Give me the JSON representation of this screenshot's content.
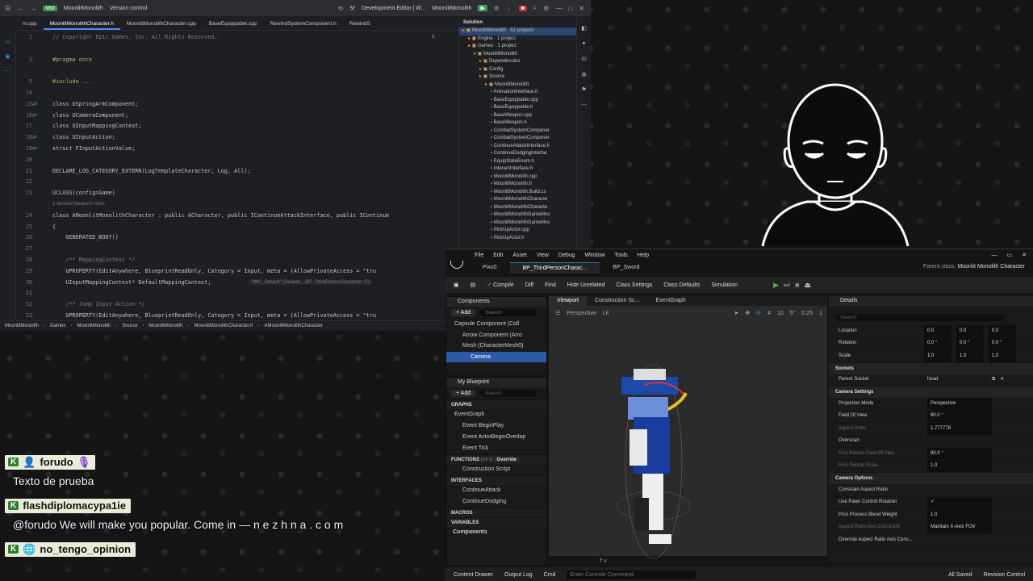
{
  "ide": {
    "title_bar": {
      "project": "MoonlitMonolith",
      "vcs": "Version control",
      "config": "Development Editor | W...",
      "run_target": "MoonlitMonolith"
    },
    "tabs": [
      "nt.cpp",
      "MoonlitMonolithCharacter.h",
      "MoonlitMonolithCharacter.cpp",
      "BaseEquippable.cpp",
      "RewindSystemComponent.h",
      "RewindS"
    ],
    "warnings": "1",
    "gutter": [
      "1",
      "",
      "3",
      "",
      "5",
      "14",
      "15",
      "16",
      "17",
      "18",
      "19",
      "20",
      "21",
      "22",
      "23",
      "",
      "24",
      "25",
      "26",
      "27",
      "28",
      "29",
      "30",
      "31",
      "32",
      "33"
    ],
    "code": [
      {
        "t": "// Copyright Epic Games, Inc. All Rights Reserved.",
        "c": "cm"
      },
      {
        "t": "",
        "c": ""
      },
      {
        "t": "#pragma once",
        "c": "pp"
      },
      {
        "t": "",
        "c": ""
      },
      {
        "t": "#include ...",
        "c": "pp"
      },
      {
        "t": "",
        "c": ""
      },
      {
        "t": "class USpringArmComponent;",
        "c": "ty"
      },
      {
        "t": "class UCameraComponent;",
        "c": "ty"
      },
      {
        "t": "class UInputMappingContext;",
        "c": "ty"
      },
      {
        "t": "class UInputAction;",
        "c": "ty"
      },
      {
        "t": "struct FInputActionValue;",
        "c": "ty"
      },
      {
        "t": "",
        "c": ""
      },
      {
        "t": "DECLARE_LOG_CATEGORY_EXTERN(LogTemplateCharacter, Log, All);",
        "c": "ty"
      },
      {
        "t": "",
        "c": ""
      },
      {
        "t": "UCLASS(config=Game)",
        "c": "ty"
      },
      {
        "t": "1 derived blueprint class",
        "c": "hint"
      },
      {
        "t": "class AMoonlitMonolithCharacter : public ACharacter, public IContinueAttackInterface, public IContinue",
        "c": "ty"
      },
      {
        "t": "{",
        "c": "ty"
      },
      {
        "t": "    GENERATED_BODY()",
        "c": "ty"
      },
      {
        "t": "",
        "c": ""
      },
      {
        "t": "    /** MappingContext */",
        "c": "cm"
      },
      {
        "t": "    UPROPERTY(EditAnywhere, BlueprintReadOnly, Category = Input, meta = (AllowPrivateAccess = \"tru",
        "c": "ty"
      },
      {
        "t": "    UInputMappingContext* DefaultMappingContext;",
        "c": "ty"
      },
      {
        "t": "",
        "c": ""
      },
      {
        "t": "    /** Jump Input Action */",
        "c": "cm"
      },
      {
        "t": "    UPROPERTY(EditAnywhere, BlueprintReadOnly, Category = Input, meta = (AllowPrivateAccess = \"tru",
        "c": "ty"
      }
    ],
    "inline_hint": "\"IMC_Default\" (Default__BP_ThirdPersonCharacter_C)",
    "solution": {
      "header": "Solution",
      "items": [
        {
          "label": "MoonlitMonolith · 52 projects",
          "indent": 0,
          "sel": true
        },
        {
          "label": "Engine · 1 project",
          "indent": 1
        },
        {
          "label": "Games · 1 project",
          "indent": 1
        },
        {
          "label": "MoonlitMonolith",
          "indent": 2
        },
        {
          "label": "Dependencies",
          "indent": 3
        },
        {
          "label": "Config",
          "indent": 3
        },
        {
          "label": "Source",
          "indent": 3
        },
        {
          "label": "MoonlitMonolith",
          "indent": 4
        },
        {
          "label": "AnimationInterface.h",
          "indent": 5
        },
        {
          "label": "BaseEquippable.cpp",
          "indent": 5
        },
        {
          "label": "BaseEquippable.h",
          "indent": 5
        },
        {
          "label": "BaseWeapon.cpp",
          "indent": 5
        },
        {
          "label": "BaseWeapon.h",
          "indent": 5
        },
        {
          "label": "CombatSystemComponer",
          "indent": 5
        },
        {
          "label": "CombatSystemComponer",
          "indent": 5
        },
        {
          "label": "ContinueAttackInterface.h",
          "indent": 5
        },
        {
          "label": "ContinueDodgingInterfac",
          "indent": 5
        },
        {
          "label": "EquipStateEnum.h",
          "indent": 5
        },
        {
          "label": "InteractInterface.h",
          "indent": 5
        },
        {
          "label": "MoonlitMonolith.cpp",
          "indent": 5
        },
        {
          "label": "MoonlitMonolith.h",
          "indent": 5
        },
        {
          "label": "MoonlitMonolith.Build.cs",
          "indent": 5
        },
        {
          "label": "MoonlitMonolithCharacte",
          "indent": 5
        },
        {
          "label": "MoonlitMonolithCharacte",
          "indent": 5
        },
        {
          "label": "MoonlitMonolithGameMoc",
          "indent": 5
        },
        {
          "label": "MoonlitMonolithGameMoc",
          "indent": 5
        },
        {
          "label": "PickUpActor.cpp",
          "indent": 5
        },
        {
          "label": "PickUpActor.h",
          "indent": 5
        }
      ]
    },
    "breadcrumb": [
      "MoonlitMonolith",
      "Games",
      "MoonlitMonolith",
      "Source",
      "MoonlitMonolith",
      "MoonlitMonolithCharacter.h",
      "AMoonlitMonolithCharacter"
    ]
  },
  "ue": {
    "menu": [
      "File",
      "Edit",
      "Asset",
      "View",
      "Debug",
      "Window",
      "Tools",
      "Help"
    ],
    "tabs": [
      "Pixo0",
      "BP_ThirdPersonCharac...",
      "BP_Sword"
    ],
    "parent_class_label": "Parent class:",
    "parent_class": "Moonlit Monolith Character",
    "toolbar": [
      "Compile",
      "Diff",
      "Find",
      "Hide Unrelated",
      "Class Settings",
      "Class Defaults",
      "Simulation"
    ],
    "components": {
      "title": "Components",
      "add": "+ Add",
      "search": "Search",
      "items": [
        {
          "label": "Capsule Component (Coll",
          "indent": 1
        },
        {
          "label": "Arrow Component (Arro",
          "indent": 2
        },
        {
          "label": "Mesh (CharacterMesh0)",
          "indent": 2
        },
        {
          "label": "Camera",
          "indent": 3,
          "sel": true
        }
      ]
    },
    "blueprint": {
      "title": "My Blueprint",
      "add": "+ Add",
      "search": "Search",
      "graphs": "GRAPHS",
      "graph_items": [
        "EventGraph",
        "Event BeginPlay",
        "Event ActorBeginOverlap",
        "Event Tick"
      ],
      "functions": "FUNCTIONS",
      "functions_count": "(34 O",
      "override": "Override",
      "function_items": [
        "Construction Script"
      ],
      "interfaces": "INTERFACES",
      "interface_items": [
        "ContinueAttack",
        "ContinueDodging"
      ],
      "macros": "MACROS",
      "variables": "VARIABLES",
      "components_var": "Components"
    },
    "viewport": {
      "tabs": [
        "Viewport",
        "Construction Sc...",
        "EventGraph"
      ],
      "perspective": "Perspective",
      "lit": "Lit",
      "grid": "10",
      "angle": "5°",
      "scale": "0.25",
      "cam": "1"
    },
    "details": {
      "title": "Details",
      "search": "Search",
      "transform": [
        {
          "label": "Location",
          "v": [
            "0.0",
            "0.0",
            "0.0"
          ]
        },
        {
          "label": "Rotation",
          "v": [
            "0.0 °",
            "0.0 °",
            "0.0 °"
          ]
        },
        {
          "label": "Scale",
          "v": [
            "1.0",
            "1.0",
            "1.0"
          ]
        }
      ],
      "sockets_title": "Sockets",
      "parent_socket_label": "Parent Socket",
      "parent_socket": "head",
      "camera_settings_title": "Camera Settings",
      "camera_settings": [
        {
          "label": "Projection Mode",
          "value": "Perspective"
        },
        {
          "label": "Field Of View",
          "value": "90.0 °"
        },
        {
          "label": "Aspect Ratio",
          "value": "1.777778",
          "dim": true
        },
        {
          "label": "Overscan",
          "value": ""
        },
        {
          "label": "First Person Field Of View",
          "value": "90.0 °",
          "dim": true
        },
        {
          "label": "First Person Scale",
          "value": "1.0",
          "dim": true
        }
      ],
      "camera_options_title": "Camera Options",
      "camera_options": [
        {
          "label": "Constrain Aspect Ratio",
          "value": ""
        },
        {
          "label": "Use Pawn Control Rotation",
          "value": "✓"
        },
        {
          "label": "Post Process Blend Weight",
          "value": "1.0"
        },
        {
          "label": "Aspect Ratio Axis Constraint",
          "value": "Maintain X-Axis FOV",
          "dim": true
        },
        {
          "label": "Override Aspect Ratio Axis Cons...",
          "value": ""
        }
      ]
    },
    "status": {
      "content_drawer": "Content Drawer",
      "output_log": "Output Log",
      "cmd": "Cmd",
      "console_placeholder": "Enter Console Command",
      "saved": "All Saved",
      "revision": "Revision Control"
    }
  },
  "chat": [
    {
      "user": "forudo",
      "message": "Texto de prueba"
    },
    {
      "user": "flashdiplomacypa1ie",
      "message": "@forudo We will make you popular. Come in — n e z h n a . c o m"
    },
    {
      "user": "no_tengo_opinion",
      "message": ""
    }
  ],
  "colors": {
    "accent": "#2f6fd0",
    "chat_badge": "#2e7d32",
    "play": "#4bb04b"
  }
}
